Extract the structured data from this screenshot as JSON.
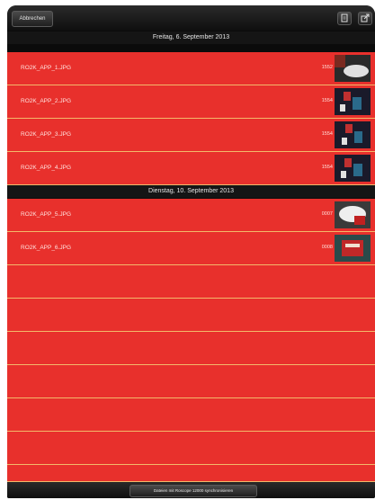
{
  "toolbar": {
    "cancel_label": "Abbrechen",
    "doc_icon": "document-icon",
    "share_icon": "share-icon"
  },
  "sections": [
    {
      "title": "Freitag, 6. September 2013",
      "items": [
        {
          "name": "RO2K_APP_1.JPG",
          "number": "1552"
        },
        {
          "name": "RO2K_APP_2.JPG",
          "number": "1554"
        },
        {
          "name": "RO2K_APP_3.JPG",
          "number": "1554"
        },
        {
          "name": "RO2K_APP_4.JPG",
          "number": "1554"
        }
      ]
    },
    {
      "title": "Dienstag, 10. September 2013",
      "items": [
        {
          "name": "RO2K_APP_5.JPG",
          "number": "0007"
        },
        {
          "name": "RO2K_APP_6.JPG",
          "number": "0008"
        }
      ]
    }
  ],
  "bottom_bar": {
    "sync_label": "Dateien mit Roscope 12000 synchronisieren"
  },
  "colors": {
    "row_bg": "#e8302c",
    "separator": "#f3b86a",
    "bar_bg": "#151515"
  }
}
